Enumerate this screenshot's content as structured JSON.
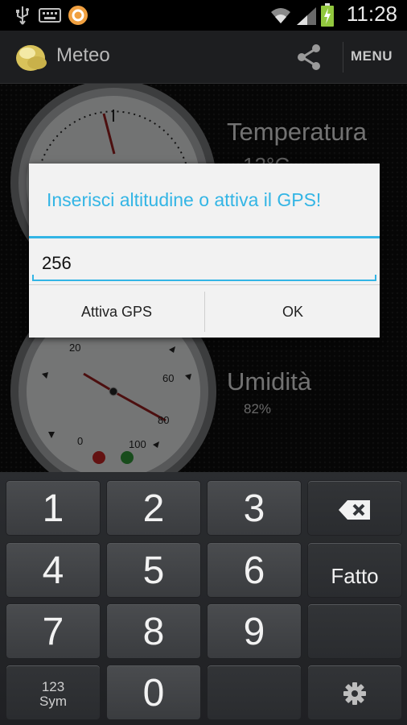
{
  "status_bar": {
    "time": "11:28",
    "icons": [
      "usb-icon",
      "keyboard-icon",
      "app-notification-icon",
      "wifi-icon",
      "signal-icon",
      "battery-charging-icon"
    ]
  },
  "action_bar": {
    "title": "Meteo",
    "menu_label": "MENU",
    "icons": [
      "app-logo-icon",
      "share-icon"
    ]
  },
  "background": {
    "temperature_label": "Temperatura",
    "temperature_value": "12°C",
    "humidity_label": "Umidità",
    "humidity_value": "82%",
    "humidity_gauge_ticks": [
      "20",
      "60",
      "80",
      "0",
      "100"
    ]
  },
  "dialog": {
    "title": "Inserisci altitudine o attiva il GPS!",
    "input_value": "256",
    "buttons": {
      "gps": "Attiva GPS",
      "ok": "OK"
    }
  },
  "keyboard": {
    "keys": [
      "1",
      "2",
      "3",
      "4",
      "5",
      "6",
      "7",
      "8",
      "9",
      "0"
    ],
    "done_label": "Fatto",
    "sym_line1": "123",
    "sym_line2": "Sym",
    "icons": [
      "backspace-icon",
      "settings-gear-icon"
    ]
  },
  "colors": {
    "accent": "#33b5e5",
    "action_bar": "#1d1e20",
    "dialog_bg": "#f2f2f2",
    "key_bg": "#434548"
  }
}
